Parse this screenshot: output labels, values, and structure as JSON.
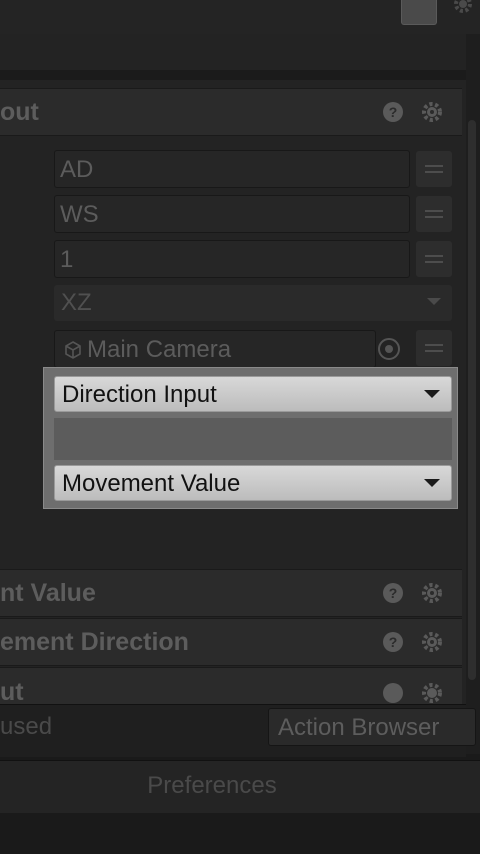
{
  "top": {
    "gear_icon": "gear-icon"
  },
  "components": [
    {
      "title": "out",
      "help_icon": "help-icon",
      "gear_icon": "gear-icon"
    },
    {
      "title": "nt Value",
      "help_icon": "help-icon",
      "gear_icon": "gear-icon"
    },
    {
      "title": "ement Direction",
      "help_icon": "help-icon",
      "gear_icon": "gear-icon"
    },
    {
      "title": "ut",
      "help_icon": "help-icon",
      "gear_icon": "gear-icon"
    }
  ],
  "fields": {
    "horizontal_axis": "AD",
    "vertical_axis": "WS",
    "multiplier": "1",
    "plane": "XZ",
    "camera": "Main Camera"
  },
  "popup": {
    "first_option": "Direction Input",
    "second_option": "Movement Value"
  },
  "bottom": {
    "status_label": "used",
    "action_browser_label": "Action Browser",
    "preferences_label": "Preferences"
  }
}
